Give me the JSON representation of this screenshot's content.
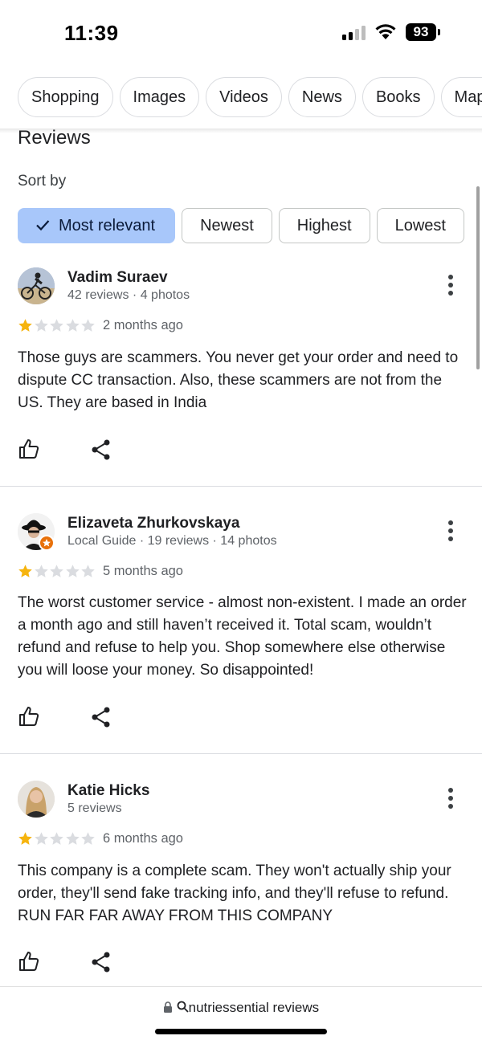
{
  "status_bar": {
    "time": "11:39",
    "battery": "93"
  },
  "search_chips": [
    "Shopping",
    "Images",
    "Videos",
    "News",
    "Books",
    "Maps"
  ],
  "reviews_section": {
    "title": "Reviews",
    "sort_label": "Sort by"
  },
  "sort_options": [
    "Most relevant",
    "Newest",
    "Highest",
    "Lowest"
  ],
  "selected_sort": "Most relevant",
  "colors": {
    "star_filled": "#f6b40e",
    "star_empty": "#dadce0",
    "active_chip": "#a8c7fa",
    "local_guide_badge": "#e8710a"
  },
  "reviews": [
    {
      "name": "Vadim Suraev",
      "meta": "42 reviews · 4 photos",
      "rating": 1,
      "date": "2 months ago",
      "text": "Those guys are scammers. You never get your order and need to dispute CC transaction. Also, these scammers are not from the US. They are based in India"
    },
    {
      "name": "Elizaveta Zhurkovskaya",
      "meta": "Local Guide · 19 reviews · 14 photos",
      "rating": 1,
      "date": "5 months ago",
      "text": "The worst customer service - almost non-existent. I made an order a month ago and still haven’t received it. Total scam, wouldn’t refund and refuse to help you. Shop somewhere else otherwise you will loose your money. So disappointed!"
    },
    {
      "name": "Katie Hicks",
      "meta": "5 reviews",
      "rating": 1,
      "date": "6 months ago",
      "text": "This company is a complete scam. They won't actually ship your order, they'll send fake tracking info, and they'll refuse to refund. RUN FAR FAR AWAY FROM THIS COMPANY"
    }
  ],
  "bottom_bar": {
    "url": "nutriessential reviews"
  }
}
